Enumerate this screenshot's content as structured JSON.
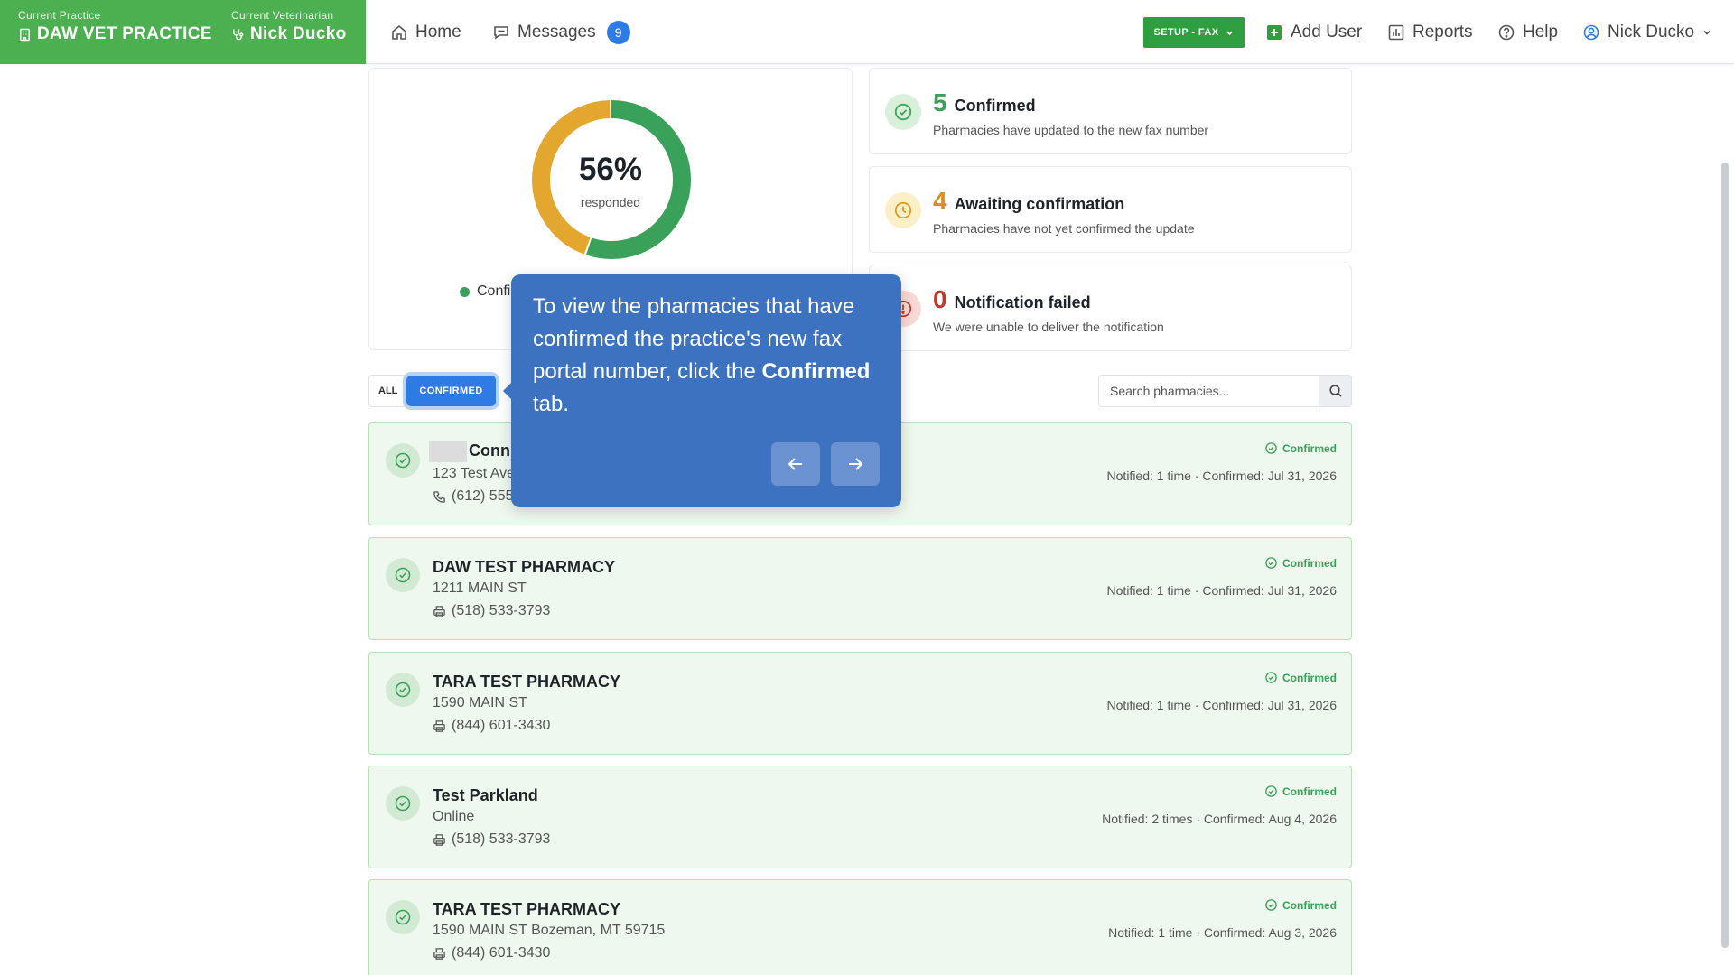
{
  "header": {
    "practice_caption": "Current Practice",
    "practice_name": "DAW VET PRACTICE",
    "vet_caption": "Current Veterinarian",
    "vet_name": "Nick Ducko",
    "nav_home": "Home",
    "nav_messages": "Messages",
    "messages_count": "9",
    "setup_label": "SETUP - FAX",
    "add_user": "Add User",
    "reports": "Reports",
    "help": "Help",
    "user_name": "Nick Ducko"
  },
  "summary": {
    "percent": "56%",
    "percent_label": "responded",
    "legend_confirmed": "Confi",
    "donut_values": {
      "confirmed": 5,
      "awaiting": 4,
      "failed": 0
    },
    "colors": {
      "confirmed": "#3aa15a",
      "awaiting": "#e3a72f",
      "failed": "#c0392b"
    }
  },
  "stats": [
    {
      "num": "5",
      "label": "Confirmed",
      "desc": "Pharmacies have updated to the new fax number"
    },
    {
      "num": "4",
      "label": "Awaiting confirmation",
      "desc": "Pharmacies have not yet confirmed the update"
    },
    {
      "num": "0",
      "label": "Notification failed",
      "desc": "We were unable to deliver the notification"
    }
  ],
  "tabs": {
    "all": "ALL",
    "confirmed": "CONFIRMED"
  },
  "search": {
    "placeholder": "Search pharmacies..."
  },
  "tooltip": {
    "text_before": "To view the pharmacies that have confirmed the practice's new fax portal number, click the ",
    "text_bold": "Confirmed",
    "text_after": " tab."
  },
  "pharmacies": [
    {
      "name": "Conn",
      "address": "123 Test Ave",
      "phone": "(612) 555",
      "status": "Confirmed",
      "meta": "Notified: 1 time · Confirmed: Jul 31, 2026"
    },
    {
      "name": "DAW TEST PHARMACY",
      "address": "1211 MAIN ST",
      "phone": "(518) 533-3793",
      "status": "Confirmed",
      "meta": "Notified: 1 time · Confirmed: Jul 31, 2026"
    },
    {
      "name": "TARA TEST PHARMACY",
      "address": "1590 MAIN ST",
      "phone": "(844) 601-3430",
      "status": "Confirmed",
      "meta": "Notified: 1 time · Confirmed: Jul 31, 2026"
    },
    {
      "name": "Test Parkland",
      "address": "Online",
      "phone": "(518) 533-3793",
      "status": "Confirmed",
      "meta": "Notified: 2 times · Confirmed: Aug 4, 2026"
    },
    {
      "name": "TARA TEST PHARMACY",
      "address": "1590 MAIN ST Bozeman, MT 59715",
      "phone": "(844) 601-3430",
      "status": "Confirmed",
      "meta": "Notified: 1 time · Confirmed: Aug 3, 2026"
    }
  ]
}
